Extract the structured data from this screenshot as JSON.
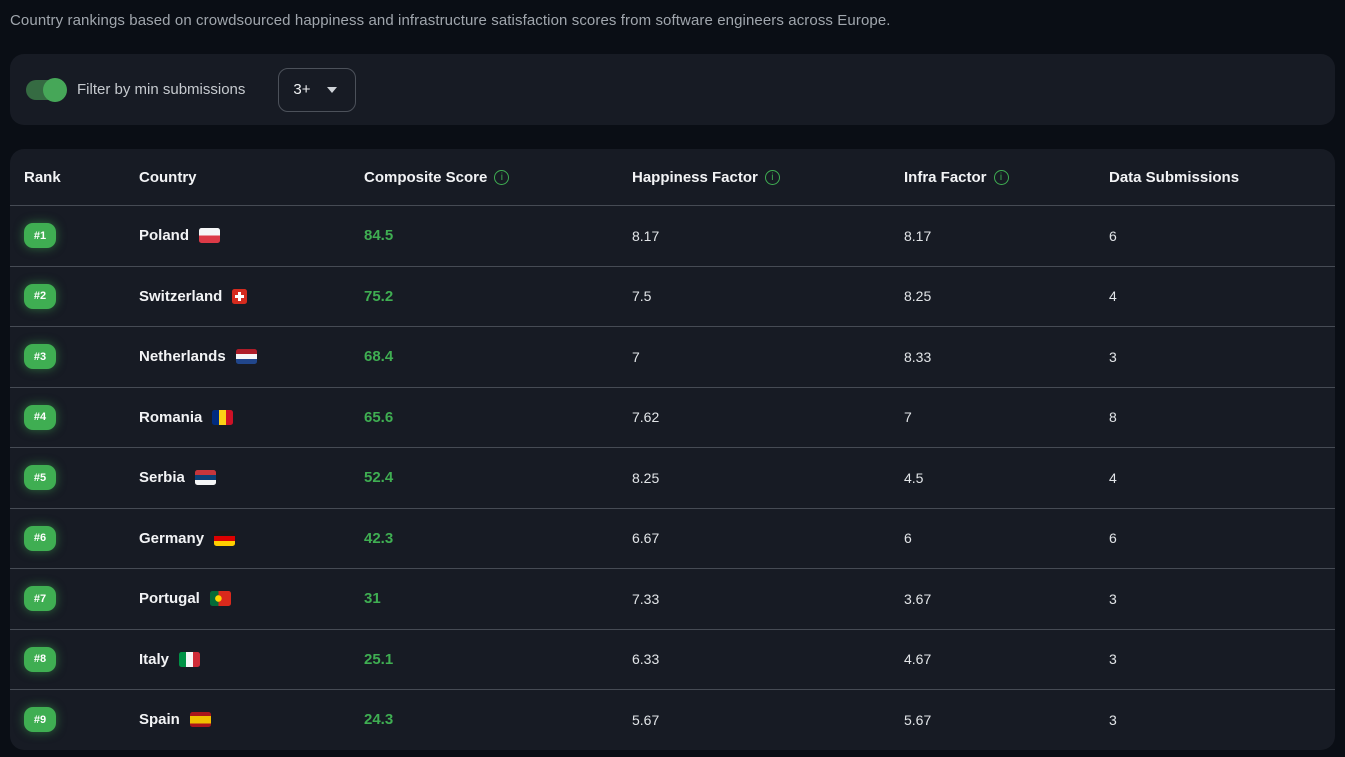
{
  "page": {
    "description": "Country rankings based on crowdsourced happiness and infrastructure satisfaction scores from software engineers across Europe."
  },
  "filter": {
    "toggle_on": true,
    "label": "Filter by min submissions",
    "dropdown_value": "3+"
  },
  "table": {
    "columns": [
      {
        "label": "Rank",
        "info": false
      },
      {
        "label": "Country",
        "info": false
      },
      {
        "label": "Composite Score",
        "info": true
      },
      {
        "label": "Happiness Factor",
        "info": true
      },
      {
        "label": "Infra Factor",
        "info": true
      },
      {
        "label": "Data Submissions",
        "info": false
      }
    ],
    "info_icon_glyph": "i",
    "rows": [
      {
        "rank": "#1",
        "country": "Poland",
        "flag": "pl",
        "composite": "84.5",
        "happiness": "8.17",
        "infra": "8.17",
        "submissions": "6"
      },
      {
        "rank": "#2",
        "country": "Switzerland",
        "flag": "ch",
        "composite": "75.2",
        "happiness": "7.5",
        "infra": "8.25",
        "submissions": "4"
      },
      {
        "rank": "#3",
        "country": "Netherlands",
        "flag": "nl",
        "composite": "68.4",
        "happiness": "7",
        "infra": "8.33",
        "submissions": "3"
      },
      {
        "rank": "#4",
        "country": "Romania",
        "flag": "ro",
        "composite": "65.6",
        "happiness": "7.62",
        "infra": "7",
        "submissions": "8"
      },
      {
        "rank": "#5",
        "country": "Serbia",
        "flag": "rs",
        "composite": "52.4",
        "happiness": "8.25",
        "infra": "4.5",
        "submissions": "4"
      },
      {
        "rank": "#6",
        "country": "Germany",
        "flag": "de",
        "composite": "42.3",
        "happiness": "6.67",
        "infra": "6",
        "submissions": "6"
      },
      {
        "rank": "#7",
        "country": "Portugal",
        "flag": "pt",
        "composite": "31",
        "happiness": "7.33",
        "infra": "3.67",
        "submissions": "3"
      },
      {
        "rank": "#8",
        "country": "Italy",
        "flag": "it",
        "composite": "25.1",
        "happiness": "6.33",
        "infra": "4.67",
        "submissions": "3"
      },
      {
        "rank": "#9",
        "country": "Spain",
        "flag": "es",
        "composite": "24.3",
        "happiness": "5.67",
        "infra": "5.67",
        "submissions": "3"
      }
    ]
  },
  "colors": {
    "accent_green": "#3fae52",
    "toggle_knob_green": "#46a758",
    "card_background": "#171b24",
    "page_background": "#0a0e15"
  }
}
